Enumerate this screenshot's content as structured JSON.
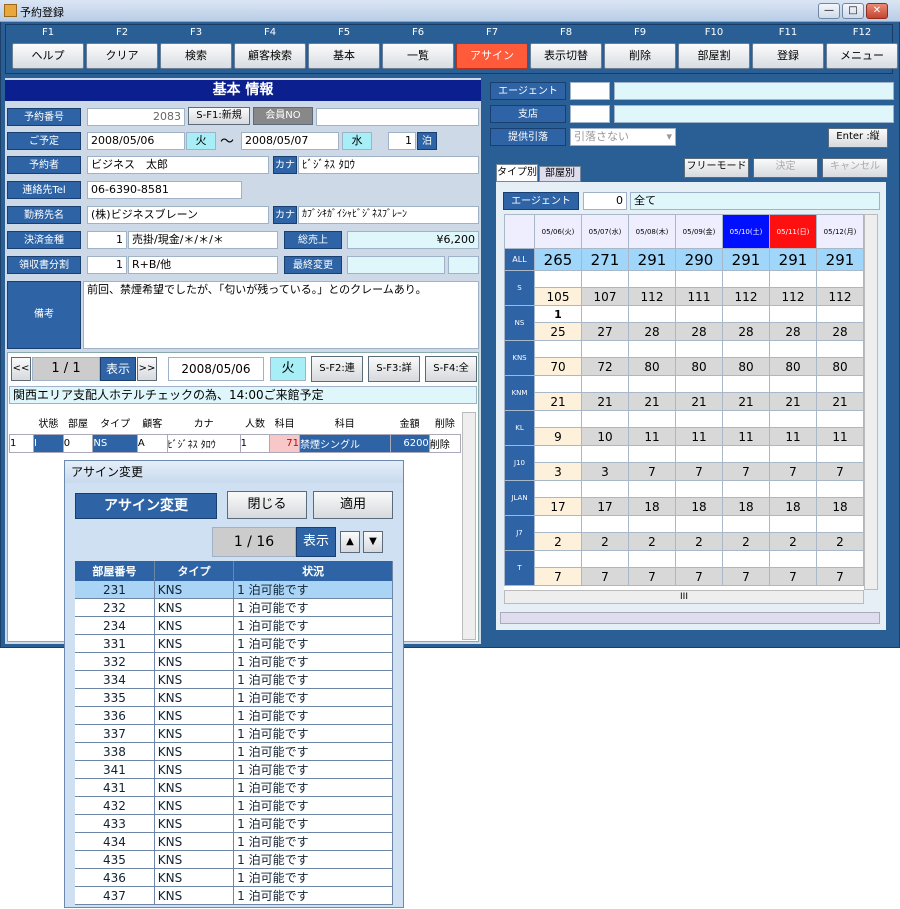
{
  "window": {
    "title": "予約登録",
    "min": "—",
    "max": "□",
    "close": "✕"
  },
  "fkeys": [
    {
      "key": "F1",
      "label": "ヘルプ"
    },
    {
      "key": "F2",
      "label": "クリア"
    },
    {
      "key": "F3",
      "label": "検索"
    },
    {
      "key": "F4",
      "label": "顧客検索"
    },
    {
      "key": "F5",
      "label": "基本"
    },
    {
      "key": "F6",
      "label": "一覧"
    },
    {
      "key": "F7",
      "label": "アサイン"
    },
    {
      "key": "F8",
      "label": "表示切替"
    },
    {
      "key": "F9",
      "label": "削除"
    },
    {
      "key": "F10",
      "label": "部屋割"
    },
    {
      "key": "F11",
      "label": "登録"
    },
    {
      "key": "F12",
      "label": "メニュー"
    }
  ],
  "basic": {
    "header": "基本 情報",
    "reservation_no_label": "予約番号",
    "reservation_no": "2083",
    "new_btn": "S-F1:新規",
    "member_btn": "会員NO",
    "schedule_label": "ご予定",
    "date_from": "2008/05/06",
    "dow_from": "火",
    "tilde": "〜",
    "date_to": "2008/05/07",
    "dow_to": "水",
    "nights": "1",
    "nights_unit": "泊",
    "booker_label": "予約者",
    "booker": "ビジネス　太郎",
    "kana_label": "カナ",
    "booker_kana": "ﾋﾞｼﾞﾈｽ ﾀﾛｳ",
    "phone_label": "連絡先Tel",
    "phone": "06-6390-8581",
    "company_label": "勤務先名",
    "company": "(株)ビジネスブレーン",
    "company_kana": "ｶﾌﾞｼｷｶﾞｲｼｬﾋﾞｼﾞﾈｽﾌﾞﾚｰﾝ",
    "payment_label": "決済金種",
    "payment_no": "1",
    "payment": "売掛/現金/＊/＊/＊",
    "total_label": "総売上",
    "total": "¥6,200",
    "receipt_label": "領収書分割",
    "receipt_no": "1",
    "receipt": "R+B/他",
    "last_change_label": "最終変更",
    "remarks_label": "備考",
    "remarks": "前回、禁煙希望でしたが、「匂いが残っている。」とのクレームあり。"
  },
  "nav": {
    "prev": "<<",
    "page": "1 / 1",
    "show": "表示",
    "next": ">>",
    "date": "2008/05/06",
    "dow": "火",
    "b1": "S-F2:連",
    "b2": "S-F3:詳",
    "b3": "S-F4:全",
    "memo": "関西エリア支配人ホテルチェックの為、14:00ご来館予定"
  },
  "detail": {
    "headers": [
      "状態",
      "部屋",
      "タイプ",
      "顧客",
      "カナ",
      "人数",
      "科目",
      "科目",
      "金額",
      "削除"
    ],
    "row": {
      "no": "1",
      "status": "I",
      "room": "0",
      "type": "NS",
      "cust": "A",
      "kana": "ﾋﾞｼﾞﾈｽ ﾀﾛｳ",
      "people": "1",
      "code": "71",
      "item": "禁煙シングル",
      "amount": "6200",
      "del": "削除"
    }
  },
  "right": {
    "agent_label": "エージェント",
    "branch_label": "支店",
    "provide_label": "提供引落",
    "provide_value": "引落さない",
    "enter_btn": "Enter :縦",
    "tab1": "タイプ別",
    "tab2": "部屋別",
    "free_mode": "フリーモード",
    "decide": "決定",
    "cancel": "キャンセル",
    "agent2_label": "エージェント",
    "agent2_no": "0",
    "agent2_value": "全て"
  },
  "grid": {
    "dates": [
      "05/06(火)",
      "05/07(水)",
      "05/08(木)",
      "05/09(金)",
      "05/10(土)",
      "05/11(日)",
      "05/12(月)"
    ],
    "rows": [
      {
        "type": "ALL",
        "values": [
          "265",
          "271",
          "291",
          "290",
          "291",
          "291",
          "291"
        ]
      },
      {
        "type": "S",
        "values": [
          "105",
          "107",
          "112",
          "111",
          "112",
          "112",
          "112"
        ]
      },
      {
        "type": "NS",
        "mark": "1",
        "values": [
          "25",
          "27",
          "28",
          "28",
          "28",
          "28",
          "28"
        ]
      },
      {
        "type": "KNS",
        "values": [
          "70",
          "72",
          "80",
          "80",
          "80",
          "80",
          "80"
        ]
      },
      {
        "type": "KNM",
        "values": [
          "21",
          "21",
          "21",
          "21",
          "21",
          "21",
          "21"
        ]
      },
      {
        "type": "KL",
        "values": [
          "9",
          "10",
          "11",
          "11",
          "11",
          "11",
          "11"
        ]
      },
      {
        "type": "J10",
        "values": [
          "3",
          "3",
          "7",
          "7",
          "7",
          "7",
          "7"
        ]
      },
      {
        "type": "JLAN",
        "values": [
          "17",
          "17",
          "18",
          "18",
          "18",
          "18",
          "18"
        ]
      },
      {
        "type": "J7",
        "values": [
          "2",
          "2",
          "2",
          "2",
          "2",
          "2",
          "2"
        ]
      },
      {
        "type": "T",
        "values": [
          "7",
          "7",
          "7",
          "7",
          "7",
          "7",
          "7"
        ]
      }
    ]
  },
  "dialog": {
    "title": "アサイン変更",
    "header": "アサイン変更",
    "close": "閉じる",
    "apply": "適用",
    "page": "1 / 16",
    "show": "表示",
    "up": "▲",
    "down": "▼",
    "columns": [
      "部屋番号",
      "タイプ",
      "状況"
    ],
    "rooms": [
      {
        "room": "231",
        "type": "KNS",
        "status": "1 泊可能です"
      },
      {
        "room": "232",
        "type": "KNS",
        "status": "1 泊可能です"
      },
      {
        "room": "234",
        "type": "KNS",
        "status": "1 泊可能です"
      },
      {
        "room": "331",
        "type": "KNS",
        "status": "1 泊可能です"
      },
      {
        "room": "332",
        "type": "KNS",
        "status": "1 泊可能です"
      },
      {
        "room": "334",
        "type": "KNS",
        "status": "1 泊可能です"
      },
      {
        "room": "335",
        "type": "KNS",
        "status": "1 泊可能です"
      },
      {
        "room": "336",
        "type": "KNS",
        "status": "1 泊可能です"
      },
      {
        "room": "337",
        "type": "KNS",
        "status": "1 泊可能です"
      },
      {
        "room": "338",
        "type": "KNS",
        "status": "1 泊可能です"
      },
      {
        "room": "341",
        "type": "KNS",
        "status": "1 泊可能です"
      },
      {
        "room": "431",
        "type": "KNS",
        "status": "1 泊可能です"
      },
      {
        "room": "432",
        "type": "KNS",
        "status": "1 泊可能です"
      },
      {
        "room": "433",
        "type": "KNS",
        "status": "1 泊可能です"
      },
      {
        "room": "434",
        "type": "KNS",
        "status": "1 泊可能です"
      },
      {
        "room": "435",
        "type": "KNS",
        "status": "1 泊可能です"
      },
      {
        "room": "436",
        "type": "KNS",
        "status": "1 泊可能です"
      },
      {
        "room": "437",
        "type": "KNS",
        "status": "1 泊可能です"
      }
    ]
  },
  "hscroll": "III"
}
